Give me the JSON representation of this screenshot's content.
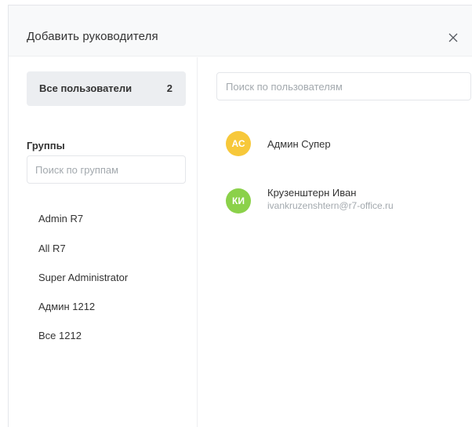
{
  "dialog": {
    "title": "Добавить руководителя",
    "close_icon": "close-icon"
  },
  "left_panel": {
    "all_users": {
      "label": "Все пользователи",
      "count": "2"
    },
    "groups_heading": "Группы",
    "group_search": {
      "placeholder": "Поиск по группам",
      "value": ""
    },
    "groups": [
      {
        "label": "Admin R7"
      },
      {
        "label": "All R7"
      },
      {
        "label": "Super Administrator"
      },
      {
        "label": "Админ 1212"
      },
      {
        "label": "Все 1212"
      }
    ]
  },
  "right_panel": {
    "user_search": {
      "placeholder": "Поиск по пользователям",
      "value": ""
    },
    "users": [
      {
        "initials": "АС",
        "name": "Админ Супер",
        "email": "",
        "avatar_color": "#f7c83a"
      },
      {
        "initials": "КИ",
        "name": "Крузенштерн Иван",
        "email": "ivankruzenshtern@r7-office.ru",
        "avatar_color": "#8bd14a"
      }
    ]
  },
  "colors": {
    "header_bg": "#f8f9fa",
    "selected_bg": "#eceef1",
    "text": "#333333",
    "muted": "#a3a9ae",
    "border": "#e4e6ea"
  }
}
